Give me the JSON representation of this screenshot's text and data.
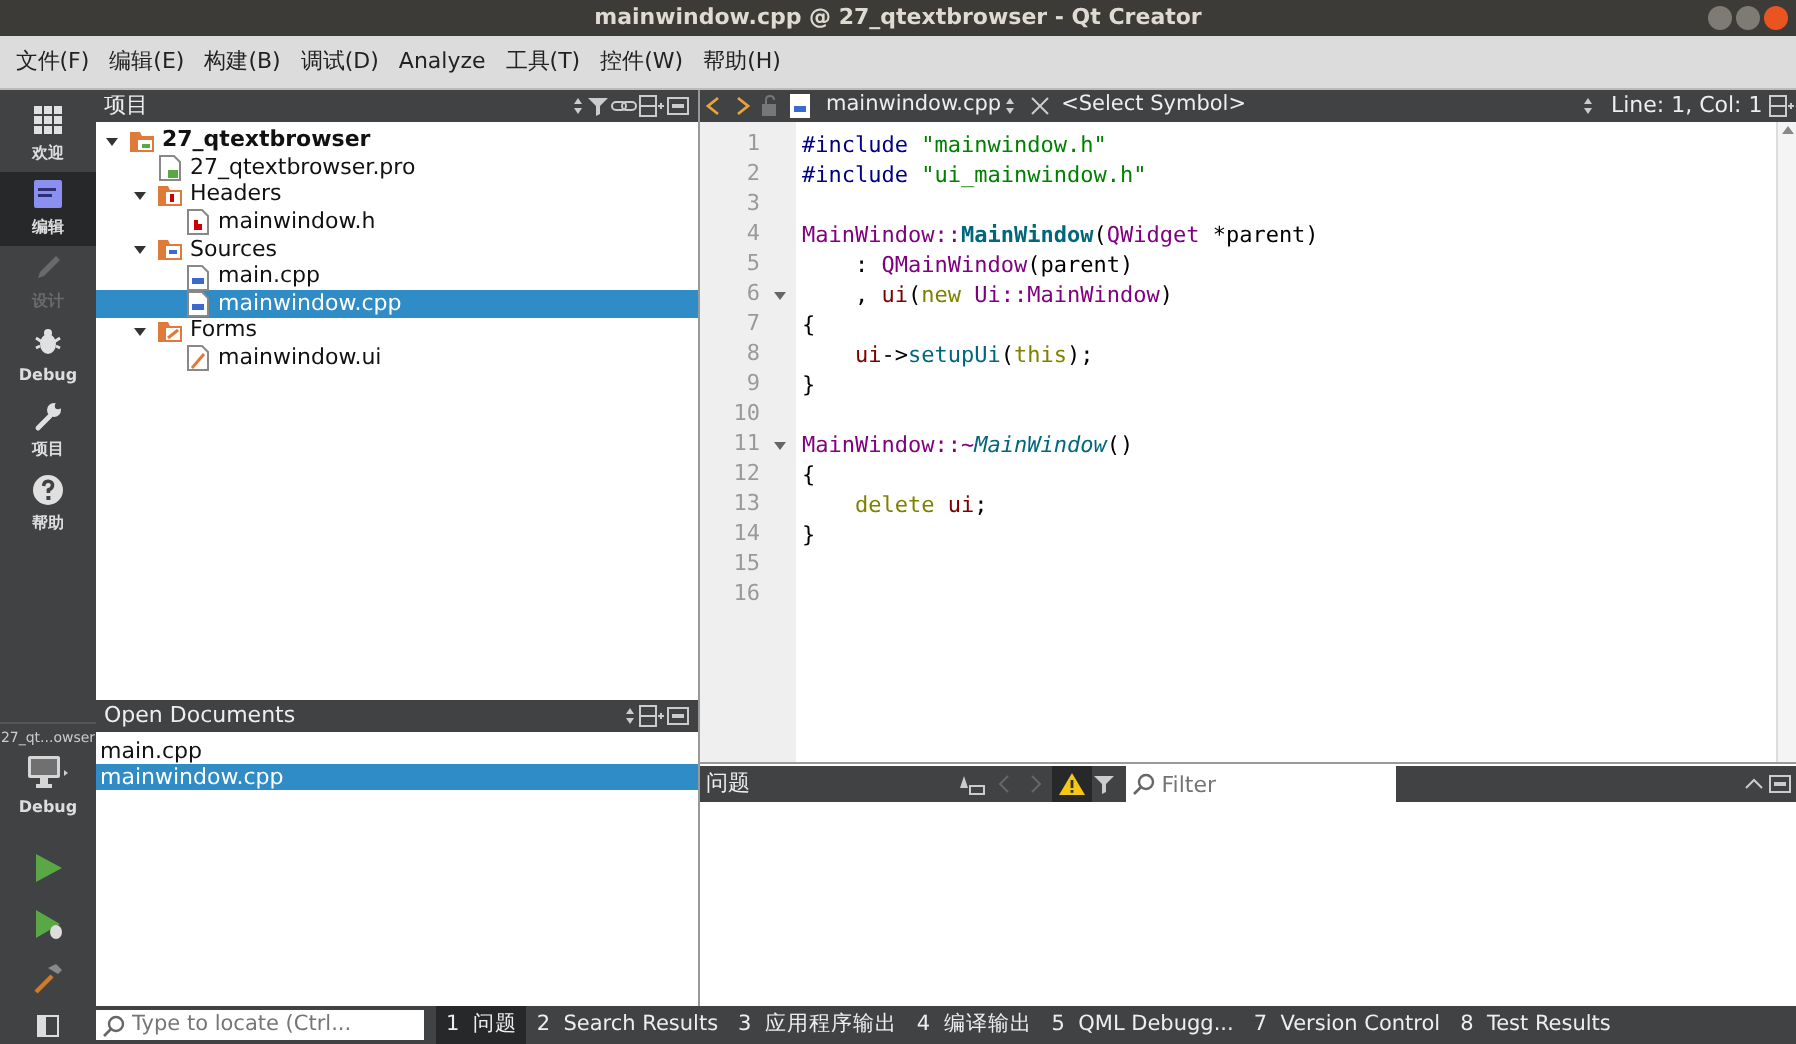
{
  "window": {
    "title": "mainwindow.cpp @ 27_qtextbrowser - Qt Creator"
  },
  "menu": [
    "文件(F)",
    "编辑(E)",
    "构建(B)",
    "调试(D)",
    "Analyze",
    "工具(T)",
    "控件(W)",
    "帮助(H)"
  ],
  "modes": [
    {
      "kind": "welcome",
      "label": "欢迎",
      "selected": false,
      "disabled": false
    },
    {
      "kind": "edit",
      "label": "编辑",
      "selected": true,
      "disabled": false
    },
    {
      "kind": "design",
      "label": "设计",
      "selected": false,
      "disabled": true
    },
    {
      "kind": "debug",
      "label": "Debug",
      "selected": false,
      "disabled": false
    },
    {
      "kind": "projects",
      "label": "项目",
      "selected": false,
      "disabled": false
    },
    {
      "kind": "help",
      "label": "帮助",
      "selected": false,
      "disabled": false
    }
  ],
  "target": {
    "project": "27_qt...owser",
    "config": "Debug"
  },
  "project_pane": {
    "title": "项目",
    "tree": [
      {
        "kind": "project",
        "label": "27_qtextbrowser",
        "expanded": true,
        "selected": false,
        "children": [
          {
            "kind": "pro",
            "label": "27_qtextbrowser.pro",
            "selected": false
          },
          {
            "kind": "headers",
            "label": "Headers",
            "expanded": true,
            "selected": false,
            "children": [
              {
                "kind": "header",
                "label": "mainwindow.h",
                "selected": false
              }
            ]
          },
          {
            "kind": "sources",
            "label": "Sources",
            "expanded": true,
            "selected": false,
            "children": [
              {
                "kind": "source",
                "label": "main.cpp",
                "selected": false
              },
              {
                "kind": "source",
                "label": "mainwindow.cpp",
                "selected": true
              }
            ]
          },
          {
            "kind": "forms",
            "label": "Forms",
            "expanded": true,
            "selected": false,
            "children": [
              {
                "kind": "form",
                "label": "mainwindow.ui",
                "selected": false
              }
            ]
          }
        ]
      }
    ]
  },
  "open_documents": {
    "title": "Open Documents",
    "items": [
      {
        "label": "main.cpp",
        "selected": false
      },
      {
        "label": "mainwindow.cpp",
        "selected": true
      }
    ]
  },
  "editor": {
    "file": "mainwindow.cpp",
    "symbol": "<Select Symbol>",
    "position": "Line: 1, Col: 1",
    "lines": [
      {
        "number": "1",
        "foldable": false,
        "tokens": [
          {
            "kind": "pre",
            "text": "#include "
          },
          {
            "kind": "str",
            "text": "\"mainwindow.h\""
          }
        ]
      },
      {
        "number": "2",
        "foldable": false,
        "tokens": [
          {
            "kind": "pre",
            "text": "#include "
          },
          {
            "kind": "str",
            "text": "\"ui_mainwindow.h\""
          }
        ]
      },
      {
        "number": "3",
        "foldable": false
      },
      {
        "number": "4",
        "foldable": false,
        "tokens": [
          {
            "kind": "cls",
            "text": "MainWindow::"
          },
          {
            "kind": "fn",
            "text": "MainWindow"
          },
          {
            "kind": "plain",
            "text": "("
          },
          {
            "kind": "cls",
            "text": "QWidget"
          },
          {
            "kind": "plain",
            "text": " *parent)"
          }
        ]
      },
      {
        "number": "5",
        "foldable": false,
        "tokens": [
          {
            "kind": "plain",
            "text": "    : "
          },
          {
            "kind": "cls",
            "text": "QMainWindow"
          },
          {
            "kind": "plain",
            "text": "(parent)"
          }
        ]
      },
      {
        "number": "6",
        "foldable": true,
        "tokens": [
          {
            "kind": "plain",
            "text": "    , "
          },
          {
            "kind": "member",
            "text": "ui"
          },
          {
            "kind": "plain",
            "text": "("
          },
          {
            "kind": "kw",
            "text": "new "
          },
          {
            "kind": "cls",
            "text": "Ui::MainWindow"
          },
          {
            "kind": "plain",
            "text": ")"
          }
        ]
      },
      {
        "number": "7",
        "foldable": false,
        "tokens": [
          {
            "kind": "plain",
            "text": "{"
          }
        ]
      },
      {
        "number": "8",
        "foldable": false,
        "indented": true,
        "tokens": [
          {
            "kind": "member",
            "text": "ui"
          },
          {
            "kind": "plain",
            "text": "->"
          },
          {
            "kind": "call",
            "text": "setupUi"
          },
          {
            "kind": "plain",
            "text": "("
          },
          {
            "kind": "kw",
            "text": "this"
          },
          {
            "kind": "plain",
            "text": ");"
          }
        ]
      },
      {
        "number": "9",
        "foldable": false,
        "tokens": [
          {
            "kind": "plain",
            "text": "}"
          }
        ]
      },
      {
        "number": "10",
        "foldable": false
      },
      {
        "number": "11",
        "foldable": true,
        "tokens": [
          {
            "kind": "cls",
            "text": "MainWindow::~"
          },
          {
            "kind": "dtor",
            "text": "MainWindow"
          },
          {
            "kind": "plain",
            "text": "()"
          }
        ]
      },
      {
        "number": "12",
        "foldable": false,
        "tokens": [
          {
            "kind": "plain",
            "text": "{"
          }
        ]
      },
      {
        "number": "13",
        "foldable": false,
        "indented": true,
        "tokens": [
          {
            "kind": "kw",
            "text": "delete "
          },
          {
            "kind": "member",
            "text": "ui"
          },
          {
            "kind": "plain",
            "text": ";"
          }
        ]
      },
      {
        "number": "14",
        "foldable": false,
        "tokens": [
          {
            "kind": "plain",
            "text": "}"
          }
        ]
      },
      {
        "number": "15",
        "foldable": false
      },
      {
        "number": "16",
        "foldable": false
      }
    ]
  },
  "issues_pane": {
    "title": "问题",
    "filter_placeholder": "Filter",
    "warnings_on": true
  },
  "status_bar": {
    "locate_placeholder": "Type to locate (Ctrl...",
    "tabs": [
      {
        "number": "1",
        "label": "问题",
        "selected": true
      },
      {
        "number": "2",
        "label": "Search Results",
        "selected": false
      },
      {
        "number": "3",
        "label": "应用程序输出",
        "selected": false
      },
      {
        "number": "4",
        "label": "编译输出",
        "selected": false
      },
      {
        "number": "5",
        "label": "QML Debugg...",
        "selected": false
      },
      {
        "number": "7",
        "label": "Version Control",
        "selected": false
      },
      {
        "number": "8",
        "label": "Test Results",
        "selected": false
      }
    ]
  }
}
